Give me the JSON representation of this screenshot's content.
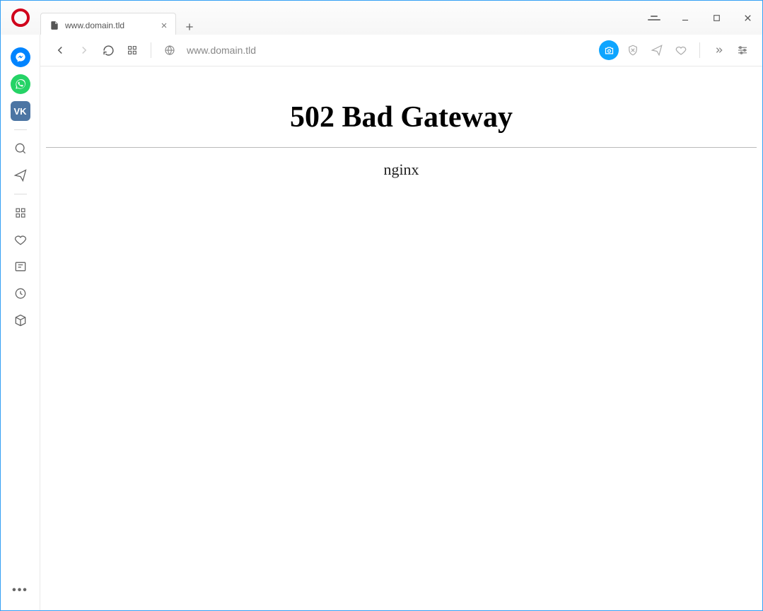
{
  "tab": {
    "title": "www.domain.tld"
  },
  "address": {
    "url": "www.domain.tld"
  },
  "page": {
    "heading": "502 Bad Gateway",
    "server": "nginx"
  },
  "sidebar": {
    "vk_label": "VK"
  }
}
